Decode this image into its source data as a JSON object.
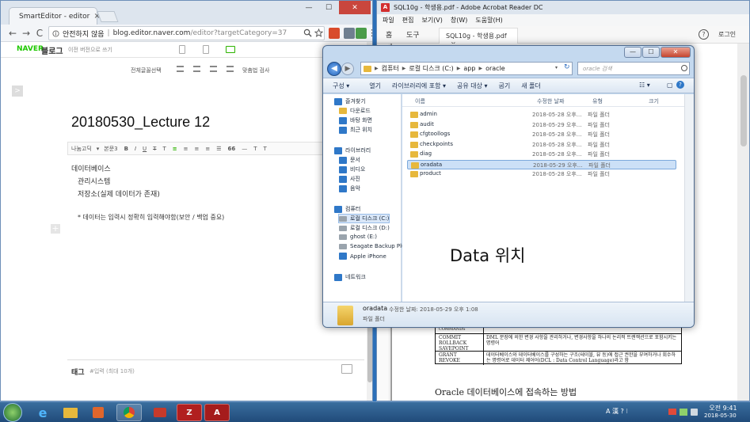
{
  "chrome": {
    "tab_title": "SmartEditor - editor",
    "tab_close": "×",
    "nav": {
      "back": "←",
      "forward": "→",
      "reload": "C"
    },
    "address": {
      "security": "안전하지 않음",
      "separator": "|",
      "url": "blog.editor.naver.com",
      "path": "/editor?targetCategory=37"
    },
    "win": {
      "min": "—",
      "max": "☐",
      "close": "✕"
    }
  },
  "editor": {
    "brand": "NAVER",
    "blog_title": "블로그",
    "prev_version": "이전 버전으로 쓰기",
    "toolbar": {
      "select_all": "전체글꼴선택",
      "spellcheck": "맞춤법 검사"
    },
    "side_toggle": ">",
    "doc_title": "20180530_Lecture 12",
    "format": {
      "font": "나눔고딕",
      "font_arrow": "▾",
      "style": "본문3",
      "bold": "B",
      "italic": "I",
      "underline": "U",
      "strike": "T",
      "superscript": "T",
      "align_left": "≡",
      "align_center": "≡",
      "align_right": "≡",
      "justify": "≡",
      "list": "☰",
      "quote": "66",
      "line": "—",
      "sup": "T",
      "sub": "T"
    },
    "body_lines": [
      "데이터베이스",
      "관리시스템",
      "저장소(실제 데이터가 존재)",
      "* 데이터는 입력시 정확히 입력해야함(보안 / 백업 중요)"
    ],
    "plus": "+",
    "tag_label": "태그",
    "tag_placeholder": "#입력 (최대 10개)"
  },
  "acrobat": {
    "title": "SQL10g - 학생용.pdf - Adobe Acrobat Reader DC",
    "icon_letter": "A",
    "menu": [
      "파일",
      "편집",
      "보기(V)",
      "창(W)",
      "도움말(H)"
    ],
    "tabs": [
      "홈",
      "도구"
    ],
    "file_tab": "SQL10g - 학생용.pdf",
    "file_tab_close": "×",
    "help": "?",
    "login": "로그인",
    "table": [
      {
        "cmd": "COMMIT\nROLLBACK\nSAVEPOINT",
        "desc": "DML 문장에 의한 변경 사항을 관리하거나, 변경사항을 하나의 논리적 트랜잭션으로 포함시키는 명령어"
      },
      {
        "cmd": "GRANT\nREVOKE",
        "desc": "데이터베이스와 데이터베이스를 구성하는 구조(테이블, 뷰 등)에 접근 권한을 부여하거나 회수하는 명령어로 데이터 제어어(DCL : Data Control Language)라고 함"
      }
    ],
    "table_cut": "COMMANDS",
    "heading": "Oracle 데이터베이스에 접속하는 방법"
  },
  "explorer": {
    "win": {
      "min": "—",
      "max": "☐",
      "close": "✕"
    },
    "nav": {
      "back": "◀",
      "forward": "▶"
    },
    "breadcrumb": [
      "컴퓨터",
      "로컬 디스크 (C:)",
      "app",
      "oracle"
    ],
    "search_placeholder": "oracle 검색",
    "commands": [
      "구성 ▾",
      "열기",
      "라이브러리에 포함 ▾",
      "공유 대상 ▾",
      "굽기",
      "새 폴더"
    ],
    "sidebar": [
      {
        "label": "즐겨찾기",
        "icon": "star-icon",
        "indent": 0
      },
      {
        "label": "다운로드",
        "icon": "folder-icon",
        "indent": 1
      },
      {
        "label": "바탕 화면",
        "icon": "desktop-icon",
        "indent": 1
      },
      {
        "label": "최근 위치",
        "icon": "recent-icon",
        "indent": 1
      },
      {
        "label": "라이브러리",
        "icon": "library-icon",
        "indent": 0
      },
      {
        "label": "문서",
        "icon": "document-icon",
        "indent": 1
      },
      {
        "label": "비디오",
        "icon": "video-icon",
        "indent": 1
      },
      {
        "label": "사진",
        "icon": "picture-icon",
        "indent": 1
      },
      {
        "label": "음악",
        "icon": "music-icon",
        "indent": 1
      },
      {
        "label": "컴퓨터",
        "icon": "computer-icon",
        "indent": 0
      },
      {
        "label": "로컬 디스크 (C:)",
        "icon": "drive-icon",
        "indent": 1
      },
      {
        "label": "로컬 디스크 (D:)",
        "icon": "drive-icon",
        "indent": 1
      },
      {
        "label": "ghost (E:)",
        "icon": "drive-icon",
        "indent": 1
      },
      {
        "label": "Seagate Backup Plu",
        "icon": "drive-icon",
        "indent": 1
      },
      {
        "label": "Apple iPhone",
        "icon": "phone-icon",
        "indent": 1
      },
      {
        "label": "네트워크",
        "icon": "network-icon",
        "indent": 0
      }
    ],
    "columns": [
      "이름",
      "수정한 날짜",
      "유형",
      "크기"
    ],
    "files": [
      {
        "name": "admin",
        "date": "2018-05-28 오후...",
        "type": "파일 폴더"
      },
      {
        "name": "audit",
        "date": "2018-05-29 오후...",
        "type": "파일 폴더"
      },
      {
        "name": "cfgtoollogs",
        "date": "2018-05-28 오후...",
        "type": "파일 폴더"
      },
      {
        "name": "checkpoints",
        "date": "2018-05-28 오후...",
        "type": "파일 폴더"
      },
      {
        "name": "diag",
        "date": "2018-05-28 오후...",
        "type": "파일 폴더"
      },
      {
        "name": "oradata",
        "date": "2018-05-29 오후...",
        "type": "파일 폴더"
      },
      {
        "name": "product",
        "date": "2018-05-28 오후...",
        "type": "파일 폴더"
      }
    ],
    "selected_index": 5,
    "annotation": "Data 위치",
    "details": {
      "name": "oradata",
      "meta": "수정한 날짜: 2018-05-29 오후 1:08",
      "type": "파일 폴더"
    }
  },
  "taskbar": {
    "apps": [
      "e",
      "",
      "",
      "",
      "",
      "Z",
      "A"
    ],
    "tray": "A 漢 ? ⁝",
    "time": "오전 9:41",
    "date": "2018-05-30"
  },
  "colors": {
    "naver_green": "#1ec800",
    "selection_blue": "#cce0f7",
    "desktop": "#2b6fb8"
  }
}
